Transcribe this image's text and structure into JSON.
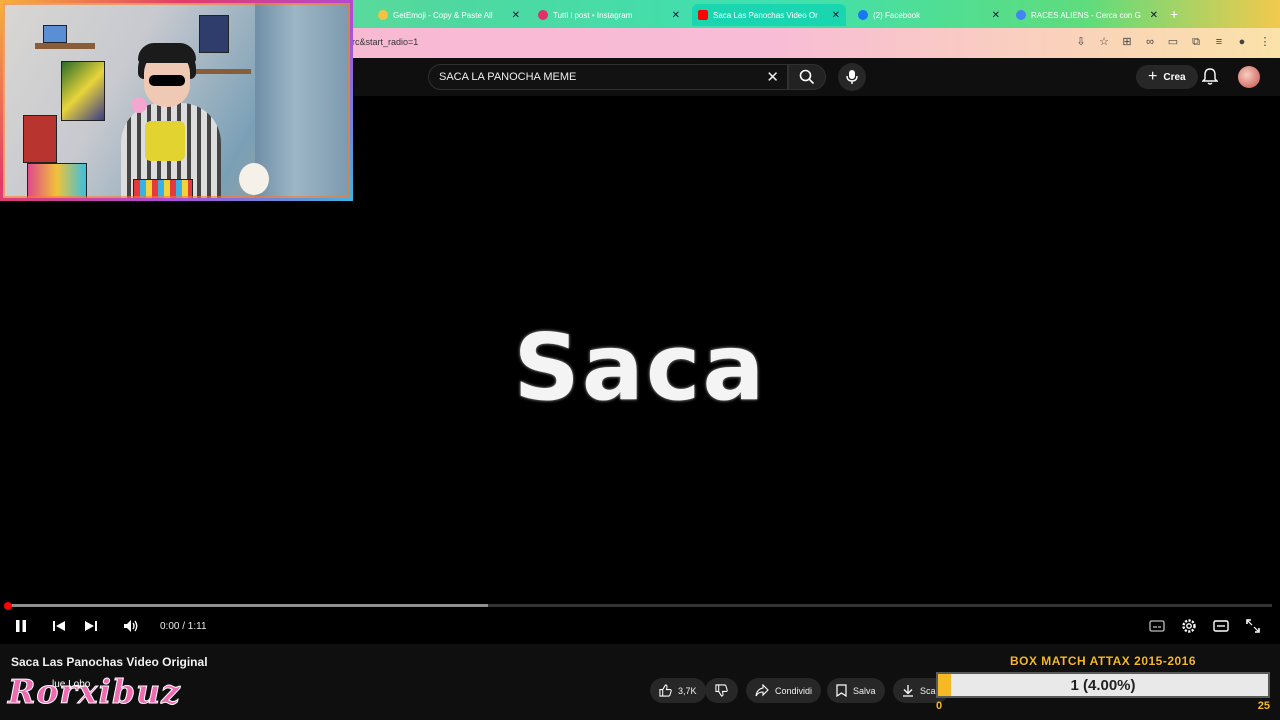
{
  "browser": {
    "tabs": [
      {
        "label": "GetEmoji - Copy & Paste All",
        "favicon_color": "#f5c342"
      },
      {
        "label": "Tutti i post • Instagram",
        "favicon_color": "#e1306c"
      },
      {
        "label": "Saca Las Panochas Video Or",
        "favicon_color": "#ff0000"
      },
      {
        "label": "(2) Facebook",
        "favicon_color": "#1877f2"
      },
      {
        "label": "RACES ALIENS - Cerca con G",
        "favicon_color": "#4285f4"
      }
    ],
    "new_tab": "+",
    "url": "rc&start_radio=1"
  },
  "youtube": {
    "search_query": "SACA LA PANOCHA MEME",
    "create_label": "Crea"
  },
  "video": {
    "caption": "Saca",
    "current_time": "0:00 / 1:11",
    "progress": 0.0,
    "buffered": 0.38,
    "title": "Saca Las Panochas Video Original",
    "channel_name": "lue Lobo"
  },
  "actions": {
    "likes": "3,7K",
    "share": "Condividi",
    "save": "Salva",
    "download": "Sca"
  },
  "overlay": {
    "logo_text": "Rorxibuz",
    "widget_title": "BOX MATCH ATTAX 2015-2016",
    "widget_value": "1 (4.00%)",
    "widget_progress": 0.04,
    "widget_min": "0",
    "widget_max": "25"
  },
  "colors": {
    "accent": "#ff0000",
    "widget_accent": "#f7b923",
    "logo_pink": "#f06ab0"
  }
}
